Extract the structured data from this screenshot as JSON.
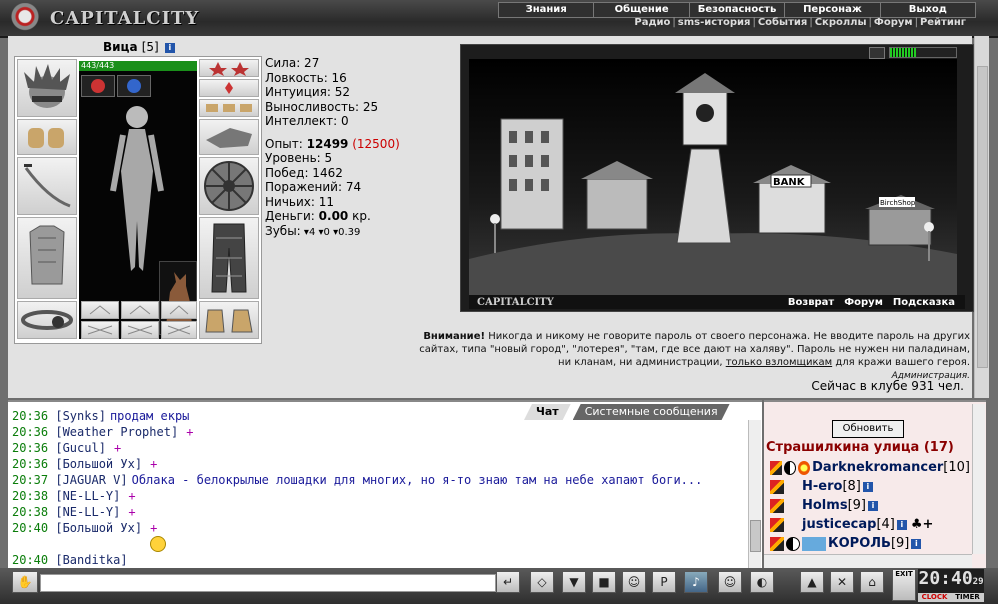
{
  "app": {
    "logo": "CAPITALCITY"
  },
  "menu": {
    "main": [
      "Знания",
      "Общение",
      "Безопасность",
      "Персонаж",
      "Выход"
    ],
    "sub": [
      "Радио",
      "sms-история",
      "События",
      "Скроллы",
      "Форум",
      "Рейтинг"
    ]
  },
  "character": {
    "name": "Вица",
    "level": "[5]",
    "hp": "443/443",
    "hp_fraction": 1.0,
    "stats": {
      "str": "Сила: 27",
      "agi": "Ловкость: 16",
      "int": "Интуиция: 52",
      "end": "Выносливость: 25",
      "wis": "Интеллект: 0"
    },
    "exp_label": "Опыт:",
    "exp_value": "12499",
    "exp_next": "(12500)",
    "level_line": "Уровень: 5",
    "wins": "Побед: 1462",
    "losses": "Поражений: 74",
    "draws": "Ничьих: 11",
    "money_label": "Деньги:",
    "money_value": "0.00",
    "money_unit": "кр.",
    "teeth_label": "Зубы:",
    "teeth_a": "4",
    "teeth_b": "0",
    "teeth_c": "0.39"
  },
  "scene": {
    "brand": "CAPITALCITY",
    "bank": "BANK",
    "shop": "BirchShop",
    "links": [
      "Возврат",
      "Форум",
      "Подсказка"
    ],
    "energy_fraction": 0.4
  },
  "warning": {
    "bold": "Внимание!",
    "text1": " Никогда и никому не говорите пароль от своего персонажа. Не вводите пароль на других сайтах, типа \"новый город\", \"лотерея\", \"там, где все дают на халяву\". Пароль не нужен ни паладинам, ни кланам, ни администрации, ",
    "underlined": "только взломщикам",
    "text2": " для кражи вашего героя.",
    "signature": "Администрация."
  },
  "online": "Сейчас в клубе 931 чел.",
  "chat": {
    "tabs": [
      "Чат",
      "Системные сообщения"
    ],
    "lines": [
      {
        "time": "20:36",
        "nick": "[Synks]",
        "msg": "продам екры",
        "plus": ""
      },
      {
        "time": "20:36",
        "nick": "[Weather Prophet]",
        "msg": "",
        "plus": "+"
      },
      {
        "time": "20:36",
        "nick": "[Gucul]",
        "msg": "",
        "plus": "+"
      },
      {
        "time": "20:36",
        "nick": "[Большой Ух]",
        "msg": "",
        "plus": "+"
      },
      {
        "time": "20:37",
        "nick": "[JAGUAR V]",
        "msg": "Облака - белокрылые лошадки для многих, но я-то знаю там на небе хапают боги...",
        "plus": ""
      },
      {
        "time": "20:38",
        "nick": "[NE-LL-Y]",
        "msg": "",
        "plus": "+"
      },
      {
        "time": "20:38",
        "nick": "[NE-LL-Y]",
        "msg": "",
        "plus": "+"
      },
      {
        "time": "20:40",
        "nick": "[Большой Ух]",
        "msg": "",
        "plus": "+"
      },
      {
        "time": "",
        "nick": "",
        "msg": "",
        "plus": ""
      },
      {
        "time": "20:40",
        "nick": "[Banditka]",
        "msg": "",
        "plus": ""
      }
    ]
  },
  "room": {
    "refresh": "Обновить",
    "title": "Страшилкина улица (17)",
    "users": [
      {
        "name": "Darknekromancer",
        "lvl": "[10]"
      },
      {
        "name": "H-ero",
        "lvl": "[8]"
      },
      {
        "name": "Holms",
        "lvl": "[9]"
      },
      {
        "name": "justicecap",
        "lvl": "[4]"
      },
      {
        "name": "КОРОЛЬ",
        "lvl": "[9]"
      }
    ]
  },
  "clock": {
    "time": "20:40",
    "sec": "29",
    "clock_label": "CLOCK",
    "timer_label": "TIMER",
    "exit": "EXIT"
  }
}
